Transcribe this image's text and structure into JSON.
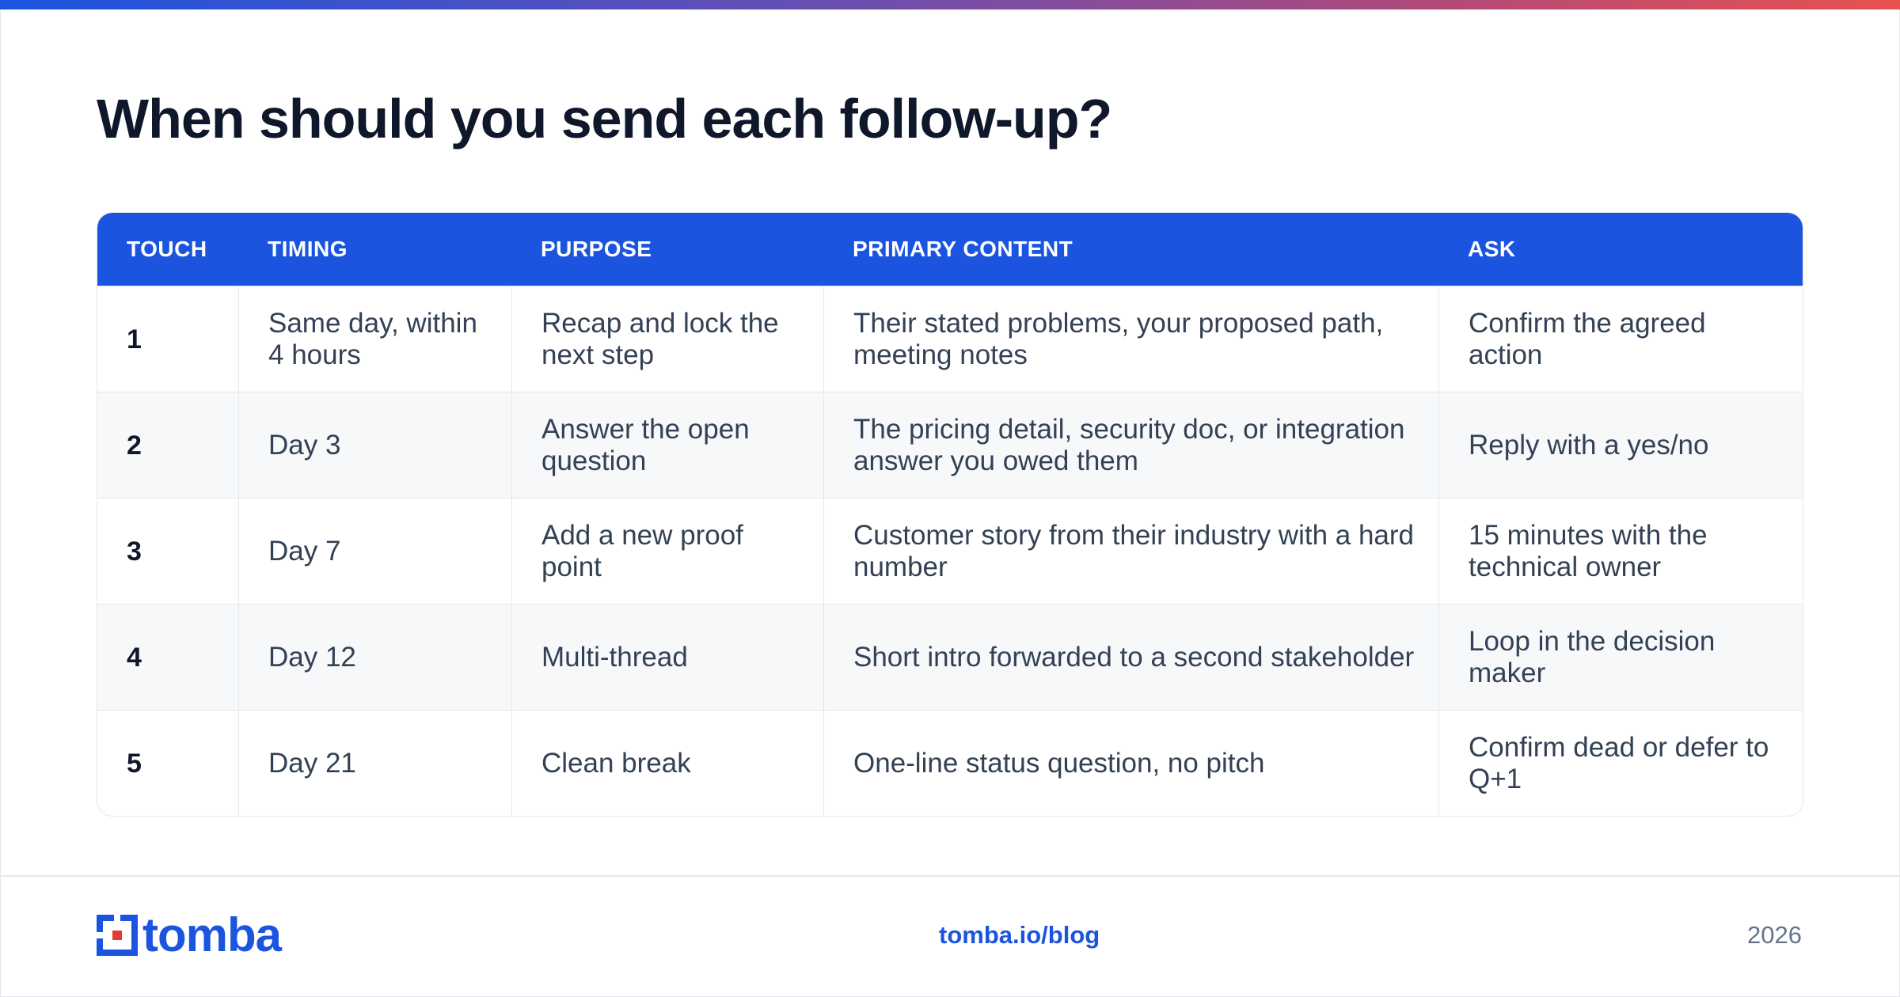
{
  "title": "When should you send each follow-up?",
  "table": {
    "headers": [
      "TOUCH",
      "TIMING",
      "PURPOSE",
      "PRIMARY CONTENT",
      "ASK"
    ],
    "rows": [
      {
        "touch": "1",
        "timing": "Same day, within 4 hours",
        "purpose": "Recap and lock the next step",
        "content": "Their stated problems, your proposed path, meeting notes",
        "ask": "Confirm the agreed action"
      },
      {
        "touch": "2",
        "timing": "Day 3",
        "purpose": "Answer the open question",
        "content": "The pricing detail, security doc, or integration answer you owed them",
        "ask": "Reply with a yes/no"
      },
      {
        "touch": "3",
        "timing": "Day 7",
        "purpose": "Add a new proof point",
        "content": "Customer story from their industry with a hard number",
        "ask": "15 minutes with the technical owner"
      },
      {
        "touch": "4",
        "timing": "Day 12",
        "purpose": "Multi-thread",
        "content": "Short intro forwarded to a second stakeholder",
        "ask": "Loop in the decision maker"
      },
      {
        "touch": "5",
        "timing": "Day 21",
        "purpose": "Clean break",
        "content": "One-line status question, no pitch",
        "ask": "Confirm dead or defer to Q+1"
      }
    ]
  },
  "footer": {
    "logo_text": "tomba",
    "link": "tomba.io/blog",
    "year": "2026"
  },
  "colors": {
    "accent": "#1b55df",
    "gradient": [
      "#1b55df",
      "#e8524f"
    ],
    "logo_red": "#e53935"
  }
}
